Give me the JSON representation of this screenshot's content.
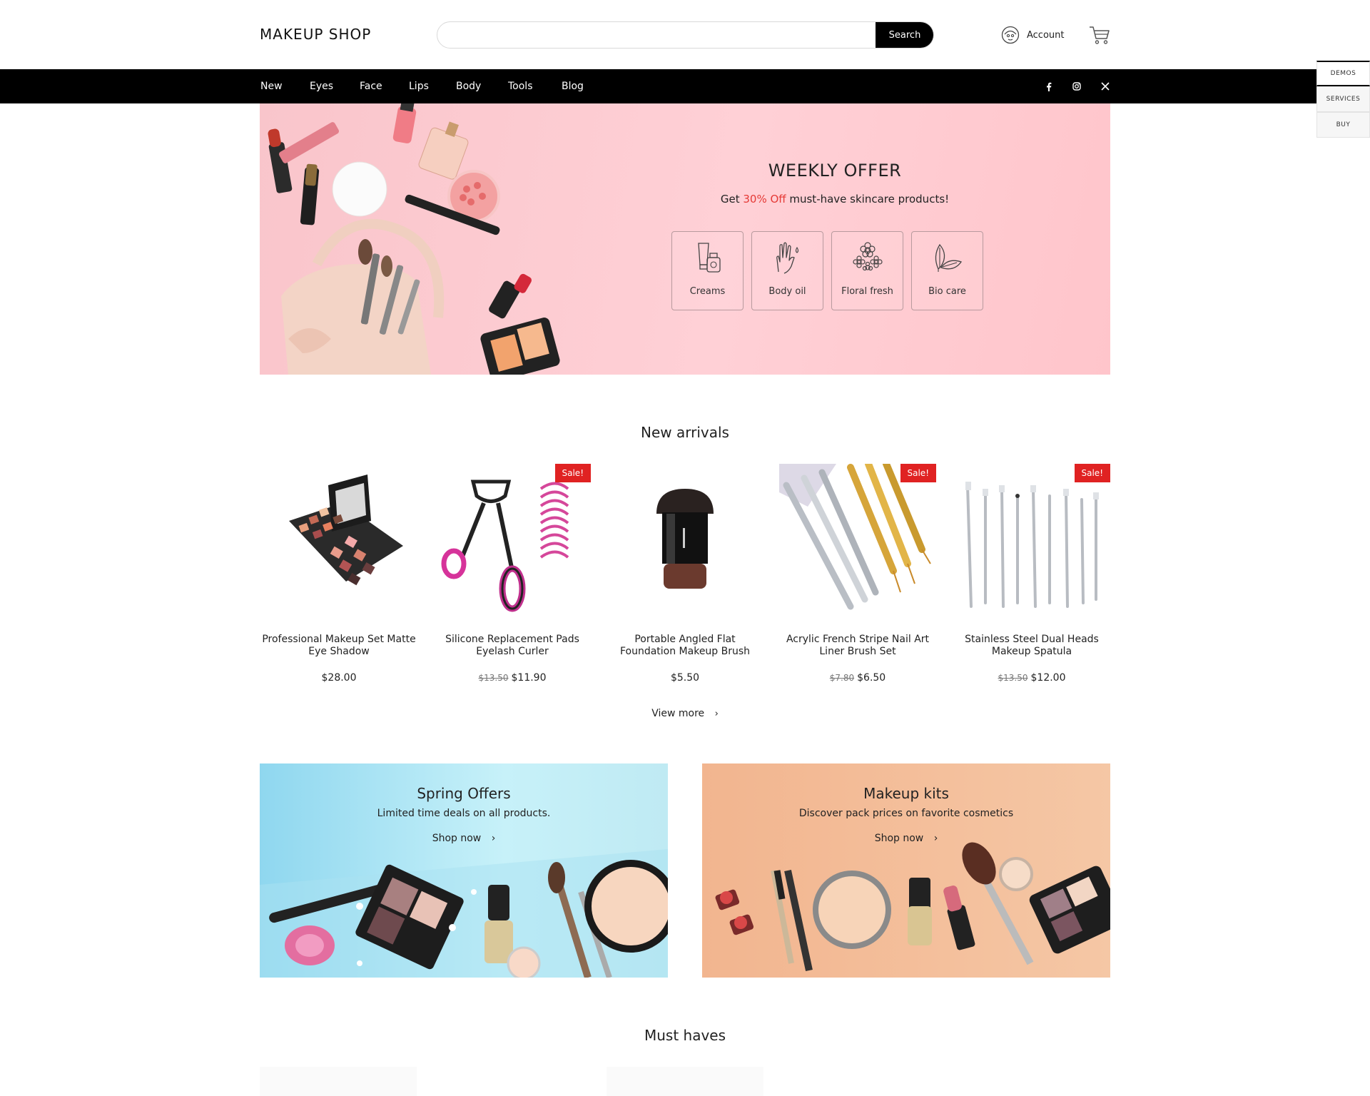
{
  "header": {
    "logo": "MAKEUP SHOP",
    "search_placeholder": "",
    "search_button": "Search",
    "account_label": "Account"
  },
  "nav": {
    "items": [
      "New",
      "Eyes",
      "Face",
      "Lips",
      "Body",
      "Tools",
      "Blog"
    ],
    "social": [
      "facebook-icon",
      "instagram-icon",
      "x-icon"
    ]
  },
  "rail": {
    "demos": "DEMOS",
    "services": "SERVICES",
    "buy": "BUY"
  },
  "hero": {
    "title": "WEEKLY OFFER",
    "sub_before": "Get ",
    "sub_highlight": "30% Off",
    "sub_after": " must-have skincare products!",
    "highlight_color": "#e53935",
    "categories": [
      {
        "label": "Creams",
        "icon": "cream-tube-icon"
      },
      {
        "label": "Body oil",
        "icon": "hand-drop-icon"
      },
      {
        "label": "Floral fresh",
        "icon": "flowers-icon"
      },
      {
        "label": "Bio care",
        "icon": "leaf-icon"
      }
    ]
  },
  "new_arrivals": {
    "title": "New arrivals",
    "sale_badge": "Sale!",
    "products": [
      {
        "name": "Professional Makeup Set Matte Eye Shadow",
        "old_price": "",
        "price": "$28.00",
        "sale": false
      },
      {
        "name": "Silicone Replacement Pads Eyelash Curler",
        "old_price": "$13.50",
        "price": "$11.90",
        "sale": true
      },
      {
        "name": "Portable Angled Flat Foundation Makeup Brush",
        "old_price": "",
        "price": "$5.50",
        "sale": false
      },
      {
        "name": "Acrylic French Stripe Nail Art Liner Brush Set",
        "old_price": "$7.80",
        "price": "$6.50",
        "sale": true
      },
      {
        "name": "Stainless Steel Dual Heads Makeup Spatula",
        "old_price": "$13.50",
        "price": "$12.00",
        "sale": true
      }
    ],
    "view_more": "View more"
  },
  "promos": [
    {
      "title": "Spring Offers",
      "subtitle": "Limited time deals on all products.",
      "link": "Shop now",
      "bg": "#bfe9f5"
    },
    {
      "title": "Makeup kits",
      "subtitle": "Discover pack prices on favorite cosmetics",
      "link": "Shop now",
      "bg": "#f0b48c"
    }
  ],
  "must_haves": {
    "title": "Must haves"
  },
  "colors": {
    "nav_bg": "#000000",
    "sale": "#e02222",
    "hero_bg": "#ffcdd3"
  }
}
